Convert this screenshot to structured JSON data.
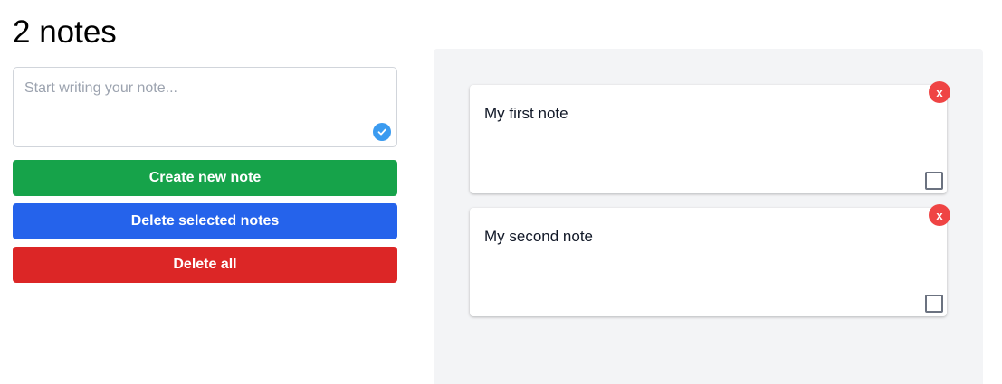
{
  "header": {
    "title": "2 notes"
  },
  "editor": {
    "placeholder": "Start writing your note...",
    "value": "",
    "status_icon": "check-circle-icon",
    "status_color": "#3b9bf0"
  },
  "actions": {
    "create_label": "Create new note",
    "delete_selected_label": "Delete selected notes",
    "delete_all_label": "Delete all",
    "colors": {
      "create": "#16a34a",
      "delete_selected": "#2563eb",
      "delete_all": "#dc2626"
    }
  },
  "notes": [
    {
      "text": "My first note",
      "close_label": "x",
      "selected": false
    },
    {
      "text": "My second note",
      "close_label": "x",
      "selected": false
    }
  ]
}
